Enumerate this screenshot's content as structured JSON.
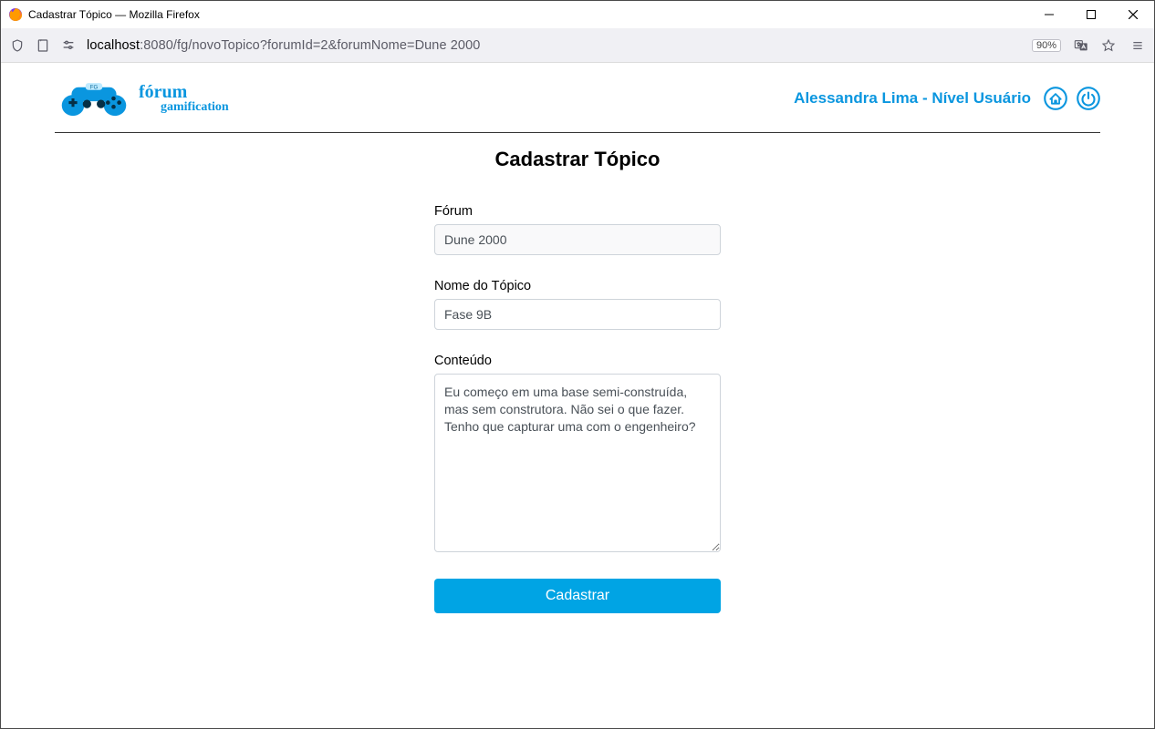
{
  "window": {
    "title": "Cadastrar Tópico — Mozilla Firefox"
  },
  "address": {
    "host": "localhost",
    "rest": ":8080/fg/novoTopico?forumId=2&forumNome=Dune 2000",
    "zoom": "90%"
  },
  "brand": {
    "line1": "fórum",
    "line2": "gamification"
  },
  "user": {
    "label": "Alessandra Lima - Nível Usuário"
  },
  "page": {
    "title": "Cadastrar Tópico"
  },
  "form": {
    "forum_label": "Fórum",
    "forum_value": "Dune 2000",
    "name_label": "Nome do Tópico",
    "name_value": "Fase 9B",
    "content_label": "Conteúdo",
    "content_value": "Eu começo em uma base semi-construída, mas sem construtora. Não sei o que fazer. Tenho que capturar uma com o engenheiro?",
    "submit_label": "Cadastrar"
  }
}
